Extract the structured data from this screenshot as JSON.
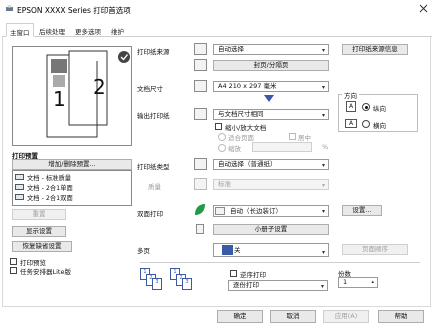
{
  "window": {
    "title": "EPSON XXXX Series 打印首选项"
  },
  "tabs": [
    {
      "label": "主窗口"
    },
    {
      "label": "后续处理"
    },
    {
      "label": "更多选项"
    },
    {
      "label": "维护"
    }
  ],
  "preview": {
    "page_number_1": "1",
    "page_number_2": "2"
  },
  "presets": {
    "label": "打印预置",
    "add_button": "增加/删除预置...",
    "items": [
      "文档 - 标准质量",
      "文档 - 2合1单面",
      "文档 - 2合1双面"
    ],
    "save_button": "显示设置",
    "display_settings_button": "显示设置",
    "restore_defaults_button": "恢复缺省设置",
    "reset_button": "重置",
    "print_preview_label": "打印预览",
    "job_arranger_label": "任务安排器Lite版"
  },
  "main": {
    "paper_source_label": "打印纸来源",
    "paper_source_value": "自动选择",
    "printer_info_button": "打印纸来源信息",
    "envelope_button": "封页/分隔页",
    "document_size_label": "文档尺寸",
    "document_size_value": "A4 210 x 297 毫米",
    "output_paper_label": "输出打印纸",
    "output_paper_value": "与文档尺寸相同",
    "reduce_enlarge_label": "缩小/放大文档",
    "fit_to_page_label": "适合页面",
    "center_label": "居中",
    "zoom_label": "缩放",
    "zoom_unit": "%",
    "paper_type_label": "打印纸类型",
    "paper_type_value": "自动选择（普通纸）",
    "quality_label": "质量",
    "quality_value": "标准",
    "orientation_label": "方向",
    "portrait_label": "纵向",
    "landscape_label": "横向",
    "duplex_label": "双面打印",
    "duplex_value": "自动（长边装订）",
    "duplex_settings_button": "设置...",
    "booklet_button": "小册子设置",
    "multipage_label": "多页",
    "multipage_value": "关",
    "page_order_button": "页面顺序",
    "reverse_order_label": "逆序打印",
    "collate_value": "逐份打印",
    "copies_label": "份数",
    "copies_value": "1"
  },
  "footer": {
    "ok": "确定",
    "cancel": "取消",
    "apply": "应用(A)",
    "help": "帮助"
  }
}
